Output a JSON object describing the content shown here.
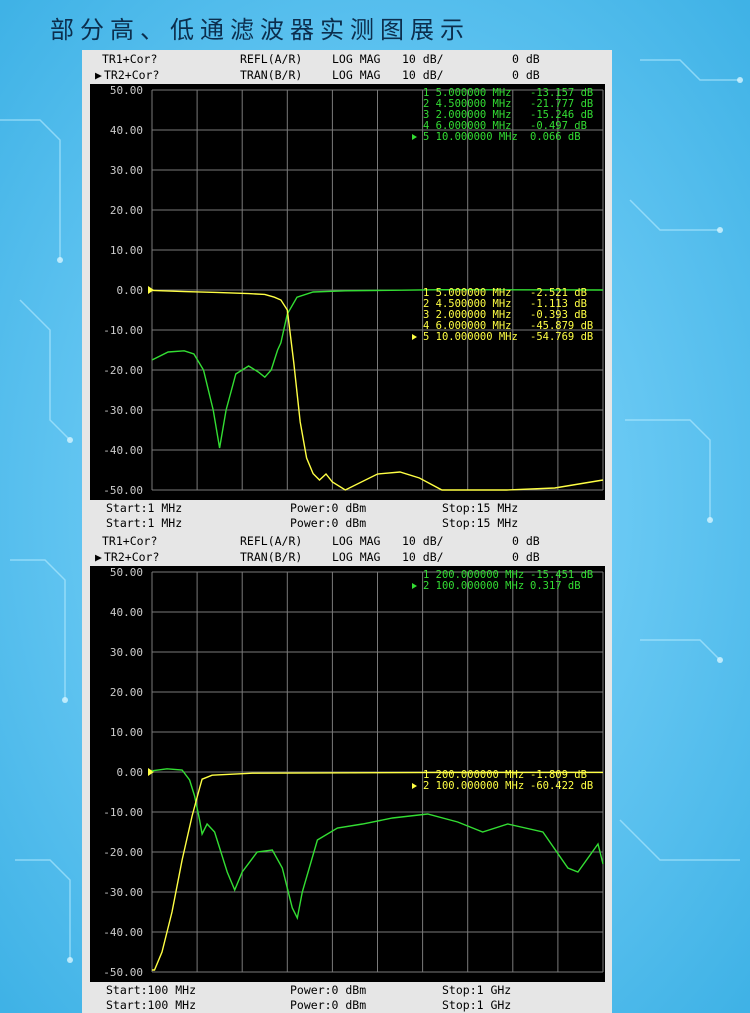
{
  "title": "部分高、低通滤波器实测图展示",
  "colors": {
    "trace1": "#33dd33",
    "trace2": "#ffff44",
    "grid": "#7a7a7a",
    "axis_text": "#cccccc"
  },
  "panels": [
    {
      "header": [
        {
          "active": false,
          "trace": "TR1+Cor?",
          "mode": "REFL(A/R)",
          "format": "LOG MAG",
          "scale": "10 dB/",
          "ref": "0 dB"
        },
        {
          "active": true,
          "trace": "TR2+Cor?",
          "mode": "TRAN(B/R)",
          "format": "LOG MAG",
          "scale": "10 dB/",
          "ref": "0 dB"
        }
      ],
      "y_ticks": [
        "50.00",
        "40.00",
        "30.00",
        "20.00",
        "10.00",
        "0.00",
        "-10.00",
        "-20.00",
        "-30.00",
        "-40.00",
        "-50.00"
      ],
      "markers_green": [
        {
          "label": "1 5.000000 MHz",
          "value": "-13.157 dB",
          "active": false
        },
        {
          "label": "2 4.500000 MHz",
          "value": "-21.777 dB",
          "active": false
        },
        {
          "label": "3 2.000000 MHz",
          "value": "-15.246 dB",
          "active": false
        },
        {
          "label": "4 6.000000 MHz",
          "value": "-0.497 dB",
          "active": false
        },
        {
          "label": "5 10.000000 MHz",
          "value": "0.066 dB",
          "active": true
        }
      ],
      "markers_yellow": [
        {
          "label": "1 5.000000 MHz",
          "value": "-2.521 dB",
          "active": false
        },
        {
          "label": "2 4.500000 MHz",
          "value": "-1.113 dB",
          "active": false
        },
        {
          "label": "3 2.000000 MHz",
          "value": "-0.393 dB",
          "active": false
        },
        {
          "label": "4 6.000000 MHz",
          "value": "-45.879 dB",
          "active": false
        },
        {
          "label": "5 10.000000 MHz",
          "value": "-54.769 dB",
          "active": true
        }
      ],
      "footer": [
        {
          "start": "Start:1 MHz",
          "power": "Power:0 dBm",
          "stop": "Stop:15 MHz"
        },
        {
          "start": "Start:1 MHz",
          "power": "Power:0 dBm",
          "stop": "Stop:15 MHz"
        }
      ]
    },
    {
      "header": [
        {
          "active": false,
          "trace": "TR1+Cor?",
          "mode": "REFL(A/R)",
          "format": "LOG MAG",
          "scale": "10 dB/",
          "ref": "0 dB"
        },
        {
          "active": true,
          "trace": "TR2+Cor?",
          "mode": "TRAN(B/R)",
          "format": "LOG MAG",
          "scale": "10 dB/",
          "ref": "0 dB"
        }
      ],
      "y_ticks": [
        "50.00",
        "40.00",
        "30.00",
        "20.00",
        "10.00",
        "0.00",
        "-10.00",
        "-20.00",
        "-30.00",
        "-40.00",
        "-50.00"
      ],
      "markers_green": [
        {
          "label": "1 200.000000 MHz",
          "value": "-15.451 dB",
          "active": false
        },
        {
          "label": "2 100.000000 MHz",
          "value": "0.317 dB",
          "active": true
        }
      ],
      "markers_yellow": [
        {
          "label": "1 200.000000 MHz",
          "value": "-1.809 dB",
          "active": false
        },
        {
          "label": "2 100.000000 MHz",
          "value": "-60.422 dB",
          "active": true
        }
      ],
      "footer": [
        {
          "start": "Start:100 MHz",
          "power": "Power:0 dBm",
          "stop": "Stop:1 GHz"
        },
        {
          "start": "Start:100 MHz",
          "power": "Power:0 dBm",
          "stop": "Stop:1 GHz"
        }
      ]
    }
  ],
  "chart_data": [
    {
      "type": "line",
      "xlabel": "",
      "ylabel": "",
      "xlim": [
        1,
        15
      ],
      "ylim": [
        -50,
        50
      ],
      "grid": true,
      "series": [
        {
          "values": [
            [
              1,
              -17.5
            ],
            [
              1.5,
              -15.5
            ],
            [
              2,
              -15.2
            ],
            [
              2.3,
              -16
            ],
            [
              2.6,
              -20
            ],
            [
              2.9,
              -30
            ],
            [
              3.1,
              -39.5
            ],
            [
              3.3,
              -30
            ],
            [
              3.6,
              -21
            ],
            [
              4,
              -19
            ],
            [
              4.3,
              -20.5
            ],
            [
              4.5,
              -21.8
            ],
            [
              4.7,
              -20
            ],
            [
              4.9,
              -15
            ],
            [
              5,
              -13.2
            ],
            [
              5.2,
              -6
            ],
            [
              5.5,
              -1.8
            ],
            [
              6,
              -0.5
            ],
            [
              7,
              -0.2
            ],
            [
              10,
              0.07
            ],
            [
              15,
              0
            ]
          ]
        },
        {
          "values": [
            [
              1,
              -0.1
            ],
            [
              2,
              -0.4
            ],
            [
              3,
              -0.6
            ],
            [
              4,
              -0.9
            ],
            [
              4.5,
              -1.1
            ],
            [
              4.8,
              -1.8
            ],
            [
              5,
              -2.5
            ],
            [
              5.2,
              -5
            ],
            [
              5.4,
              -18
            ],
            [
              5.6,
              -33
            ],
            [
              5.8,
              -42
            ],
            [
              6,
              -45.9
            ],
            [
              6.2,
              -47.5
            ],
            [
              6.4,
              -46
            ],
            [
              6.6,
              -48
            ],
            [
              7,
              -50
            ],
            [
              8,
              -46
            ],
            [
              8.7,
              -45.5
            ],
            [
              9.3,
              -47
            ],
            [
              10,
              -50
            ],
            [
              12,
              -50
            ],
            [
              13.5,
              -49.5
            ],
            [
              15,
              -47.5
            ]
          ]
        }
      ]
    },
    {
      "type": "line",
      "xlabel": "",
      "ylabel": "",
      "xlim": [
        100,
        1000
      ],
      "ylim": [
        -50,
        50
      ],
      "grid": true,
      "series": [
        {
          "values": [
            [
              100,
              0.3
            ],
            [
              130,
              0.8
            ],
            [
              160,
              0.5
            ],
            [
              175,
              -2
            ],
            [
              185,
              -6
            ],
            [
              195,
              -12
            ],
            [
              200,
              -15.5
            ],
            [
              210,
              -13
            ],
            [
              225,
              -15
            ],
            [
              250,
              -25
            ],
            [
              265,
              -29.5
            ],
            [
              280,
              -25
            ],
            [
              310,
              -20
            ],
            [
              340,
              -19.5
            ],
            [
              360,
              -24
            ],
            [
              380,
              -34
            ],
            [
              390,
              -36.5
            ],
            [
              400,
              -30
            ],
            [
              430,
              -17
            ],
            [
              470,
              -14
            ],
            [
              520,
              -13
            ],
            [
              580,
              -11.5
            ],
            [
              650,
              -10.5
            ],
            [
              710,
              -12.5
            ],
            [
              760,
              -15
            ],
            [
              810,
              -13
            ],
            [
              880,
              -15
            ],
            [
              930,
              -24
            ],
            [
              950,
              -25
            ],
            [
              990,
              -18
            ],
            [
              1000,
              -23
            ]
          ]
        },
        {
          "values": [
            [
              100,
              -49.5
            ],
            [
              105,
              -49.5
            ],
            [
              120,
              -45
            ],
            [
              140,
              -35
            ],
            [
              160,
              -22
            ],
            [
              180,
              -11
            ],
            [
              195,
              -4
            ],
            [
              200,
              -1.8
            ],
            [
              220,
              -0.8
            ],
            [
              300,
              -0.3
            ],
            [
              500,
              -0.2
            ],
            [
              700,
              -0.1
            ],
            [
              1000,
              -0.1
            ]
          ]
        }
      ]
    }
  ]
}
